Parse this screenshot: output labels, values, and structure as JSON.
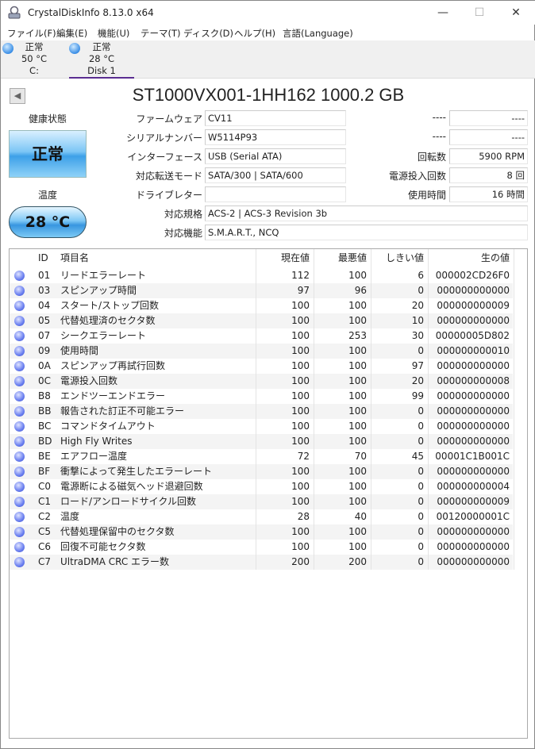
{
  "window": {
    "title": "CrystalDiskInfo 8.13.0 x64",
    "minimize": "—",
    "maximize": "☐",
    "close": "✕"
  },
  "menu": [
    "ファイル(F)",
    "編集(E)",
    "機能(U)",
    "テーマ(T)",
    "ディスク(D)",
    "ヘルプ(H)",
    "言語(Language)"
  ],
  "disks": [
    {
      "status": "正常",
      "temp": "50 °C",
      "name": "C:"
    },
    {
      "status": "正常",
      "temp": "28 °C",
      "name": "Disk 1"
    }
  ],
  "model": "ST1000VX001-1HH162 1000.2 GB",
  "health": {
    "label": "健康状態",
    "value": "正常",
    "color": "#3da0e8"
  },
  "temperature": {
    "label": "温度",
    "value": "28 °C"
  },
  "info": {
    "firmware_label": "ファームウェア",
    "firmware": "CV11",
    "serial_label": "シリアルナンバー",
    "serial": "W5114P93",
    "interface_label": "インターフェース",
    "interface": "USB (Serial ATA)",
    "transfer_label": "対応転送モード",
    "transfer": "SATA/300 | SATA/600",
    "drive_letter_label": "ドライブレター",
    "drive_letter": "",
    "standard_label": "対応規格",
    "standard": "ACS-2 | ACS-3 Revision 3b",
    "features_label": "対応機能",
    "features": "S.M.A.R.T., NCQ",
    "r1_label": "----",
    "r1": "----",
    "r2_label": "----",
    "r2": "----",
    "rpm_label": "回転数",
    "rpm": "5900 RPM",
    "power_count_label": "電源投入回数",
    "power_count": "8 回",
    "hours_label": "使用時間",
    "hours": "16 時間"
  },
  "smart": {
    "headers": {
      "id": "ID",
      "name": "項目名",
      "current": "現在値",
      "worst": "最悪値",
      "threshold": "しきい値",
      "raw": "生の値"
    },
    "rows": [
      [
        "01",
        "リードエラーレート",
        "112",
        "100",
        "6",
        "000002CD26F0"
      ],
      [
        "03",
        "スピンアップ時間",
        "97",
        "96",
        "0",
        "000000000000"
      ],
      [
        "04",
        "スタート/ストップ回数",
        "100",
        "100",
        "20",
        "000000000009"
      ],
      [
        "05",
        "代替処理済のセクタ数",
        "100",
        "100",
        "10",
        "000000000000"
      ],
      [
        "07",
        "シークエラーレート",
        "100",
        "253",
        "30",
        "00000005D802"
      ],
      [
        "09",
        "使用時間",
        "100",
        "100",
        "0",
        "000000000010"
      ],
      [
        "0A",
        "スピンアップ再試行回数",
        "100",
        "100",
        "97",
        "000000000000"
      ],
      [
        "0C",
        "電源投入回数",
        "100",
        "100",
        "20",
        "000000000008"
      ],
      [
        "B8",
        "エンドツーエンドエラー",
        "100",
        "100",
        "99",
        "000000000000"
      ],
      [
        "BB",
        "報告された訂正不可能エラー",
        "100",
        "100",
        "0",
        "000000000000"
      ],
      [
        "BC",
        "コマンドタイムアウト",
        "100",
        "100",
        "0",
        "000000000000"
      ],
      [
        "BD",
        "High Fly Writes",
        "100",
        "100",
        "0",
        "000000000000"
      ],
      [
        "BE",
        "エアフロー温度",
        "72",
        "70",
        "45",
        "00001C1B001C"
      ],
      [
        "BF",
        "衝撃によって発生したエラーレート",
        "100",
        "100",
        "0",
        "000000000000"
      ],
      [
        "C0",
        "電源断による磁気ヘッド退避回数",
        "100",
        "100",
        "0",
        "000000000004"
      ],
      [
        "C1",
        "ロード/アンロードサイクル回数",
        "100",
        "100",
        "0",
        "000000000009"
      ],
      [
        "C2",
        "温度",
        "28",
        "40",
        "0",
        "00120000001C"
      ],
      [
        "C5",
        "代替処理保留中のセクタ数",
        "100",
        "100",
        "0",
        "000000000000"
      ],
      [
        "C6",
        "回復不可能セクタ数",
        "100",
        "100",
        "0",
        "000000000000"
      ],
      [
        "C7",
        "UltraDMA CRC エラー数",
        "200",
        "200",
        "0",
        "000000000000"
      ]
    ]
  }
}
